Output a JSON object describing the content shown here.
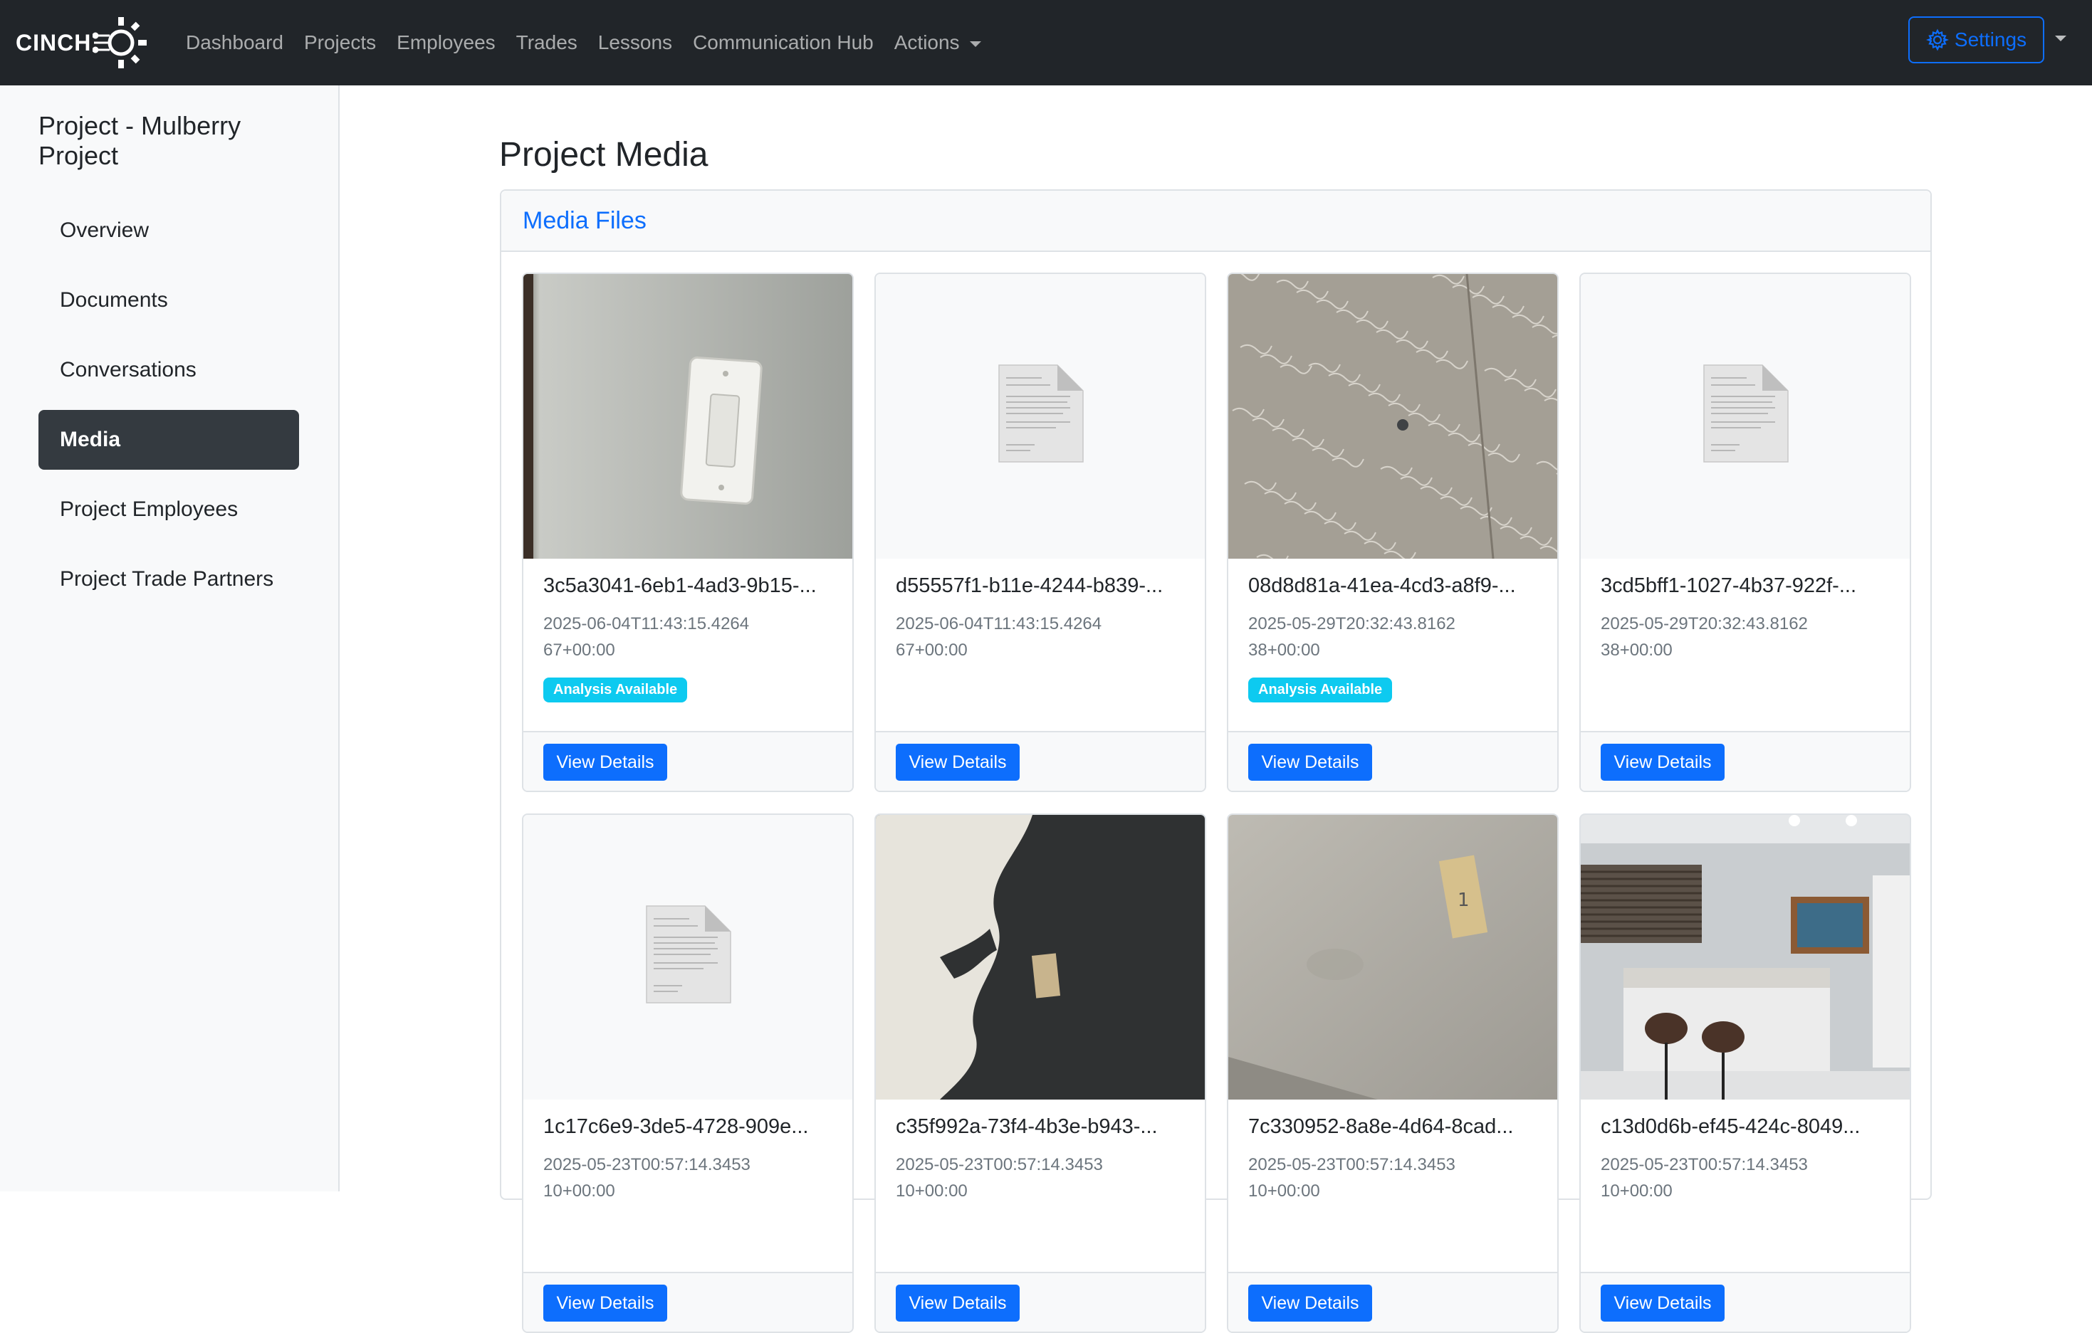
{
  "navbar": {
    "brand": "CINCH",
    "links": [
      "Dashboard",
      "Projects",
      "Employees",
      "Trades",
      "Lessons",
      "Communication Hub"
    ],
    "actions_label": "Actions",
    "settings_label": "Settings"
  },
  "sidebar": {
    "title": "Project - Mulberry Project",
    "items": [
      {
        "label": "Overview"
      },
      {
        "label": "Documents"
      },
      {
        "label": "Conversations"
      },
      {
        "label": "Media",
        "active": true
      },
      {
        "label": "Project Employees"
      },
      {
        "label": "Project Trade Partners"
      }
    ]
  },
  "main": {
    "title": "Project Media",
    "card_header": "Media Files",
    "view_button_label": "View Details",
    "badge_label": "Analysis Available",
    "media": [
      {
        "name": "3c5a3041-6eb1-4ad3-9b15-...",
        "date": "2025-06-04T11:43:15.426467+00:00",
        "analysis": true,
        "thumb": "light-switch-photo"
      },
      {
        "name": "d55557f1-b11e-4244-b839-...",
        "date": "2025-06-04T11:43:15.426467+00:00",
        "analysis": false,
        "thumb": "document-icon"
      },
      {
        "name": "08d8d81a-41ea-4cd3-a8f9-...",
        "date": "2025-05-29T20:32:43.816238+00:00",
        "analysis": true,
        "thumb": "textured-surface-photo"
      },
      {
        "name": "3cd5bff1-1027-4b37-922f-...",
        "date": "2025-05-29T20:32:43.816238+00:00",
        "analysis": false,
        "thumb": "document-icon"
      },
      {
        "name": "1c17c6e9-3de5-4728-909e...",
        "date": "2025-05-23T00:57:14.345310+00:00",
        "analysis": false,
        "thumb": "document-icon"
      },
      {
        "name": "c35f992a-73f4-4b3e-b943-...",
        "date": "2025-05-23T00:57:14.345310+00:00",
        "analysis": false,
        "thumb": "dark-wall-damage-photo"
      },
      {
        "name": "7c330952-8a8e-4d64-8cad...",
        "date": "2025-05-23T00:57:14.345310+00:00",
        "analysis": false,
        "thumb": "wall-tag-photo"
      },
      {
        "name": "c13d0d6b-ef45-424c-8049...",
        "date": "2025-05-23T00:57:14.345310+00:00",
        "analysis": false,
        "thumb": "kitchen-photo"
      }
    ]
  },
  "colors": {
    "navbar_bg": "#212529",
    "primary": "#0d6efd",
    "badge": "#0dcaf0",
    "sidebar_active": "#343a40"
  }
}
